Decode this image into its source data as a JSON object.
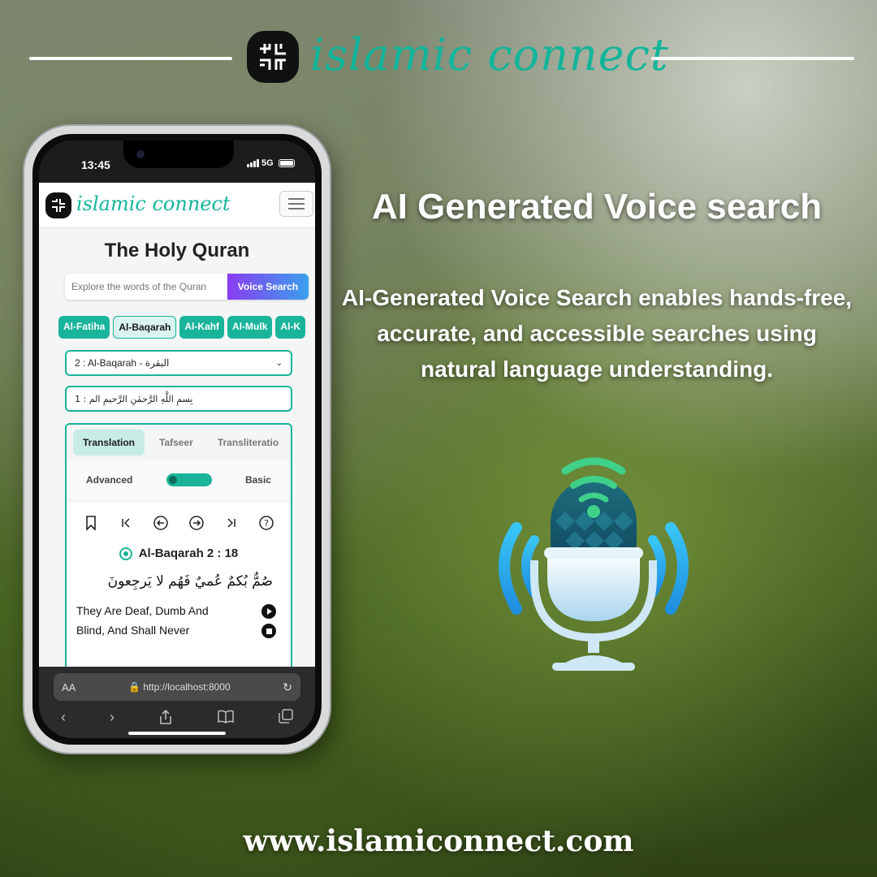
{
  "brand": {
    "name": "islamic connect",
    "color": "#12b59a"
  },
  "phone": {
    "time": "13:45",
    "network": "5G",
    "navbar": {
      "brand": "islamic connect"
    },
    "page_title": "The Holy Quran",
    "search": {
      "placeholder": "Explore the words of the Quran",
      "button": "Voice Search"
    },
    "chips": [
      "Al-Fatiha",
      "Al-Baqarah",
      "Al-Kahf",
      "Al-Mulk",
      "Al-K"
    ],
    "surah_select": "2 : Al-Baqarah - البقرة",
    "verse_select": "بِسمِ اللَّهِ الرَّحمٰنِ الرَّحيمِ الم : 1",
    "tabs": [
      "Translation",
      "Tafseer",
      "Transliteratio"
    ],
    "mode": {
      "left": "Advanced",
      "right": "Basic"
    },
    "tool_icons": [
      "bookmark-icon",
      "first-icon",
      "prev-icon",
      "next-icon",
      "last-icon",
      "help-icon"
    ],
    "verse_ref": "Al-Baqarah 2 : 18",
    "arabic_text": "صُمٌّ بُكمٌ عُميٌ فَهُم لا يَرجِعونَ",
    "translation_line1": "They Are Deaf, Dumb And",
    "translation_line2": "Blind, And Shall Never",
    "safari": {
      "aa": "AA",
      "url": "http://localhost:8000"
    }
  },
  "heading": "AI Generated Voice search",
  "description": "AI-Generated Voice Search enables hands-free, accurate, and accessible searches using natural language understanding.",
  "footer_url": "www.islamiconnect.com"
}
